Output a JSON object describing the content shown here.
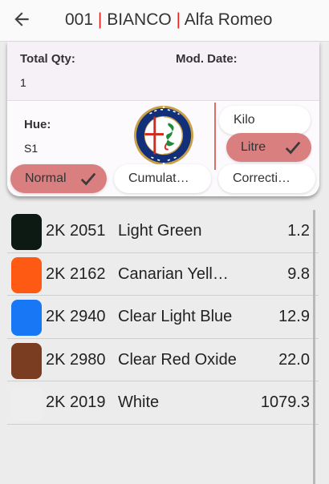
{
  "header": {
    "title_code": "001",
    "title_sep": "|",
    "title_name": "BIANCO",
    "title_brand": "Alfa Romeo"
  },
  "summary": {
    "total_qty_label": "Total Qty:",
    "total_qty_value": "1",
    "mod_date_label": "Mod. Date:",
    "mod_date_value": "",
    "hue_label": "Hue:",
    "hue_value": "S1"
  },
  "options": {
    "kilo": "Kilo",
    "litre": "Litre",
    "normal": "Normal",
    "cumulative": "Cumulat…",
    "correction": "Correcti…"
  },
  "ingredients": [
    {
      "code": "2K 2051",
      "name": "Light Green",
      "qty": "1.2",
      "color": "#0d1a14"
    },
    {
      "code": "2K 2162",
      "name": "Canarian Yell…",
      "qty": "9.8",
      "color": "#ff5a14"
    },
    {
      "code": "2K 2940",
      "name": "Clear Light Blue",
      "qty": "12.9",
      "color": "#1877f5"
    },
    {
      "code": "2K 2980",
      "name": "Clear Red Oxide",
      "qty": "22.0",
      "color": "#7a3d21"
    },
    {
      "code": "2K 2019",
      "name": "White",
      "qty": "1079.3",
      "color": "#eeeeee"
    }
  ],
  "colors": {
    "accent": "#d97f7f",
    "separator_red": "#e2231a"
  }
}
